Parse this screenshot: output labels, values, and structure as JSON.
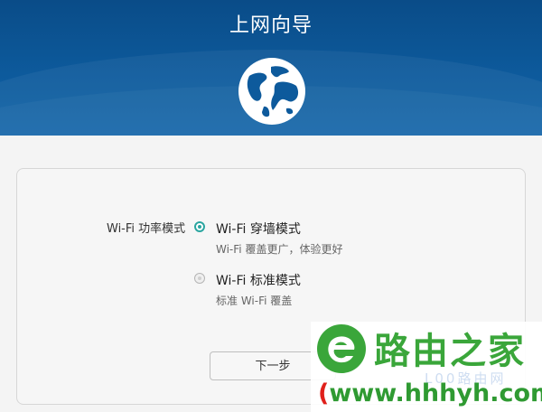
{
  "header": {
    "title": "上网向导",
    "icon": "globe-icon",
    "background_color": "#0d5a9c"
  },
  "form": {
    "label": "Wi-Fi 功率模式",
    "options": [
      {
        "title": "Wi-Fi 穿墙模式",
        "description": "Wi-Fi 覆盖更广，体验更好",
        "selected": true
      },
      {
        "title": "Wi-Fi 标准模式",
        "description": "标准 Wi-Fi 覆盖",
        "selected": false
      }
    ],
    "accent_color": "#2aa5a0"
  },
  "next_button": {
    "label": "下一步"
  },
  "watermark": {
    "name": "路由之家",
    "url_open": "(",
    "url_main": "www.hhhyh.com",
    "url_close": ")",
    "faint_text": "L00路由网",
    "brand_color": "#3aa63a",
    "url_color": "#e0201b"
  }
}
